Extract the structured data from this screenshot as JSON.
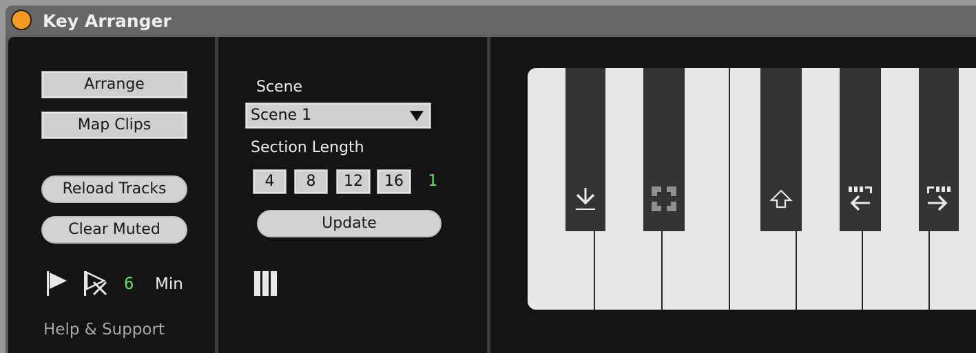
{
  "window": {
    "title": "Key Arranger",
    "accent_color": "#f49a23"
  },
  "left_panel": {
    "arrange_label": "Arrange",
    "map_clips_label": "Map Clips",
    "reload_tracks_label": "Reload Tracks",
    "clear_muted_label": "Clear Muted",
    "flag_icon": "flag-icon",
    "unflag_icon": "flag-x-icon",
    "count_value": "6",
    "unit_label": "Min",
    "help_label": "Help & Support"
  },
  "middle_panel": {
    "scene_label": "Scene",
    "scene_selected": "Scene 1",
    "section_length_label": "Section Length",
    "length_options": [
      "4",
      "8",
      "12",
      "16"
    ],
    "length_value": "1",
    "update_label": "Update",
    "bars_icon": "columns-icon"
  },
  "keyboard": {
    "black_key_icons": [
      "download-icon",
      "fullscreen-icon",
      "up-arrow-icon",
      "insert-left-icon",
      "insert-right-icon"
    ]
  }
}
